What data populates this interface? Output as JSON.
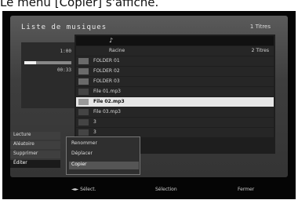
{
  "caption": "Le menu [Copier] s'affiche.",
  "screen": {
    "title": "Liste de musiques",
    "count_label": "1 Titres",
    "left": {
      "time_total": "1:00",
      "time_elapsed": "00:33",
      "progress": 0.25
    },
    "list_header": "Racine",
    "list_header_count": "2 Titres",
    "rows": [
      {
        "label": "FOLDER 01",
        "type": "folder"
      },
      {
        "label": "FOLDER 02",
        "type": "folder"
      },
      {
        "label": "FOLDER 03",
        "type": "folder"
      },
      {
        "label": "File 01.mp3",
        "type": "file"
      },
      {
        "label": "File 02.mp3",
        "type": "file",
        "selected": true
      },
      {
        "label": "File 03.mp3",
        "type": "file"
      },
      {
        "label": "3",
        "type": "file"
      },
      {
        "label": "3",
        "type": "file"
      }
    ],
    "commands": [
      "Lecture",
      "Aléatoire",
      "Supprimer",
      "Éditer"
    ],
    "active_command": "Éditer",
    "submenu": [
      "Renommer",
      "Déplacer",
      "Copier"
    ],
    "submenu_selected": "Copier",
    "hints": {
      "select": "◄► Sélect.",
      "page": "Sélection",
      "close": "Fermer"
    }
  }
}
